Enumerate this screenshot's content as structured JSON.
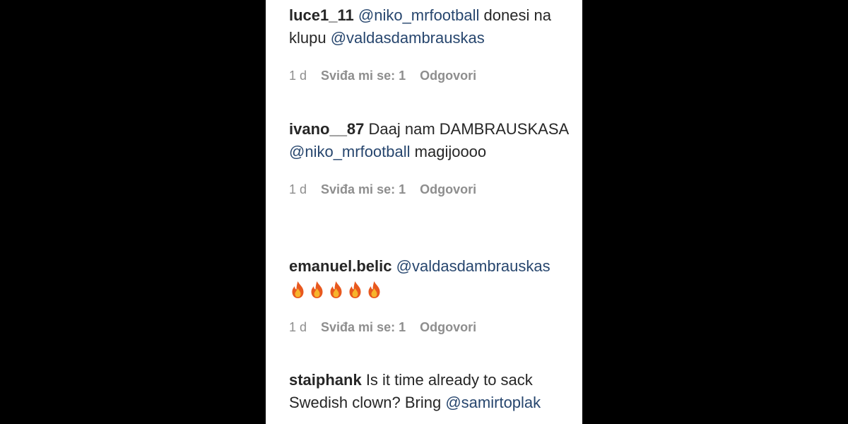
{
  "comments": [
    {
      "username": "luce1_11",
      "segments": [
        {
          "type": "mention",
          "text": "@niko_mrfootball"
        },
        {
          "type": "text",
          "text": " donesi na klupu "
        },
        {
          "type": "mention",
          "text": "@valdasdambrauskas"
        }
      ],
      "time": "1 d",
      "likes": "Sviđa mi se: 1",
      "reply": "Odgovori"
    },
    {
      "username": "ivano__87",
      "segments": [
        {
          "type": "text",
          "text": " Daaj nam DAMBRAUSKASA "
        },
        {
          "type": "mention",
          "text": "@niko_mrfootball"
        },
        {
          "type": "text",
          "text": " magijoooo"
        }
      ],
      "time": "1 d",
      "likes": "Sviđa mi se: 1",
      "reply": "Odgovori"
    },
    {
      "username": "emanuel.belic",
      "segments": [
        {
          "type": "mention",
          "text": "@valdasdambrauskas"
        }
      ],
      "emoji_count": 5,
      "emoji": "fire-icon",
      "time": "1 d",
      "likes": "Sviđa mi se: 1",
      "reply": "Odgovori"
    },
    {
      "username": "staiphank",
      "segments": [
        {
          "type": "text",
          "text": " Is it time already to sack Swedish clown? Bring "
        },
        {
          "type": "mention",
          "text": "@samirtoplak"
        }
      ]
    }
  ],
  "colors": {
    "background": "#000000",
    "panel": "#ffffff",
    "text": "#262626",
    "mention": "#27466e",
    "meta": "#8e8e8e"
  }
}
